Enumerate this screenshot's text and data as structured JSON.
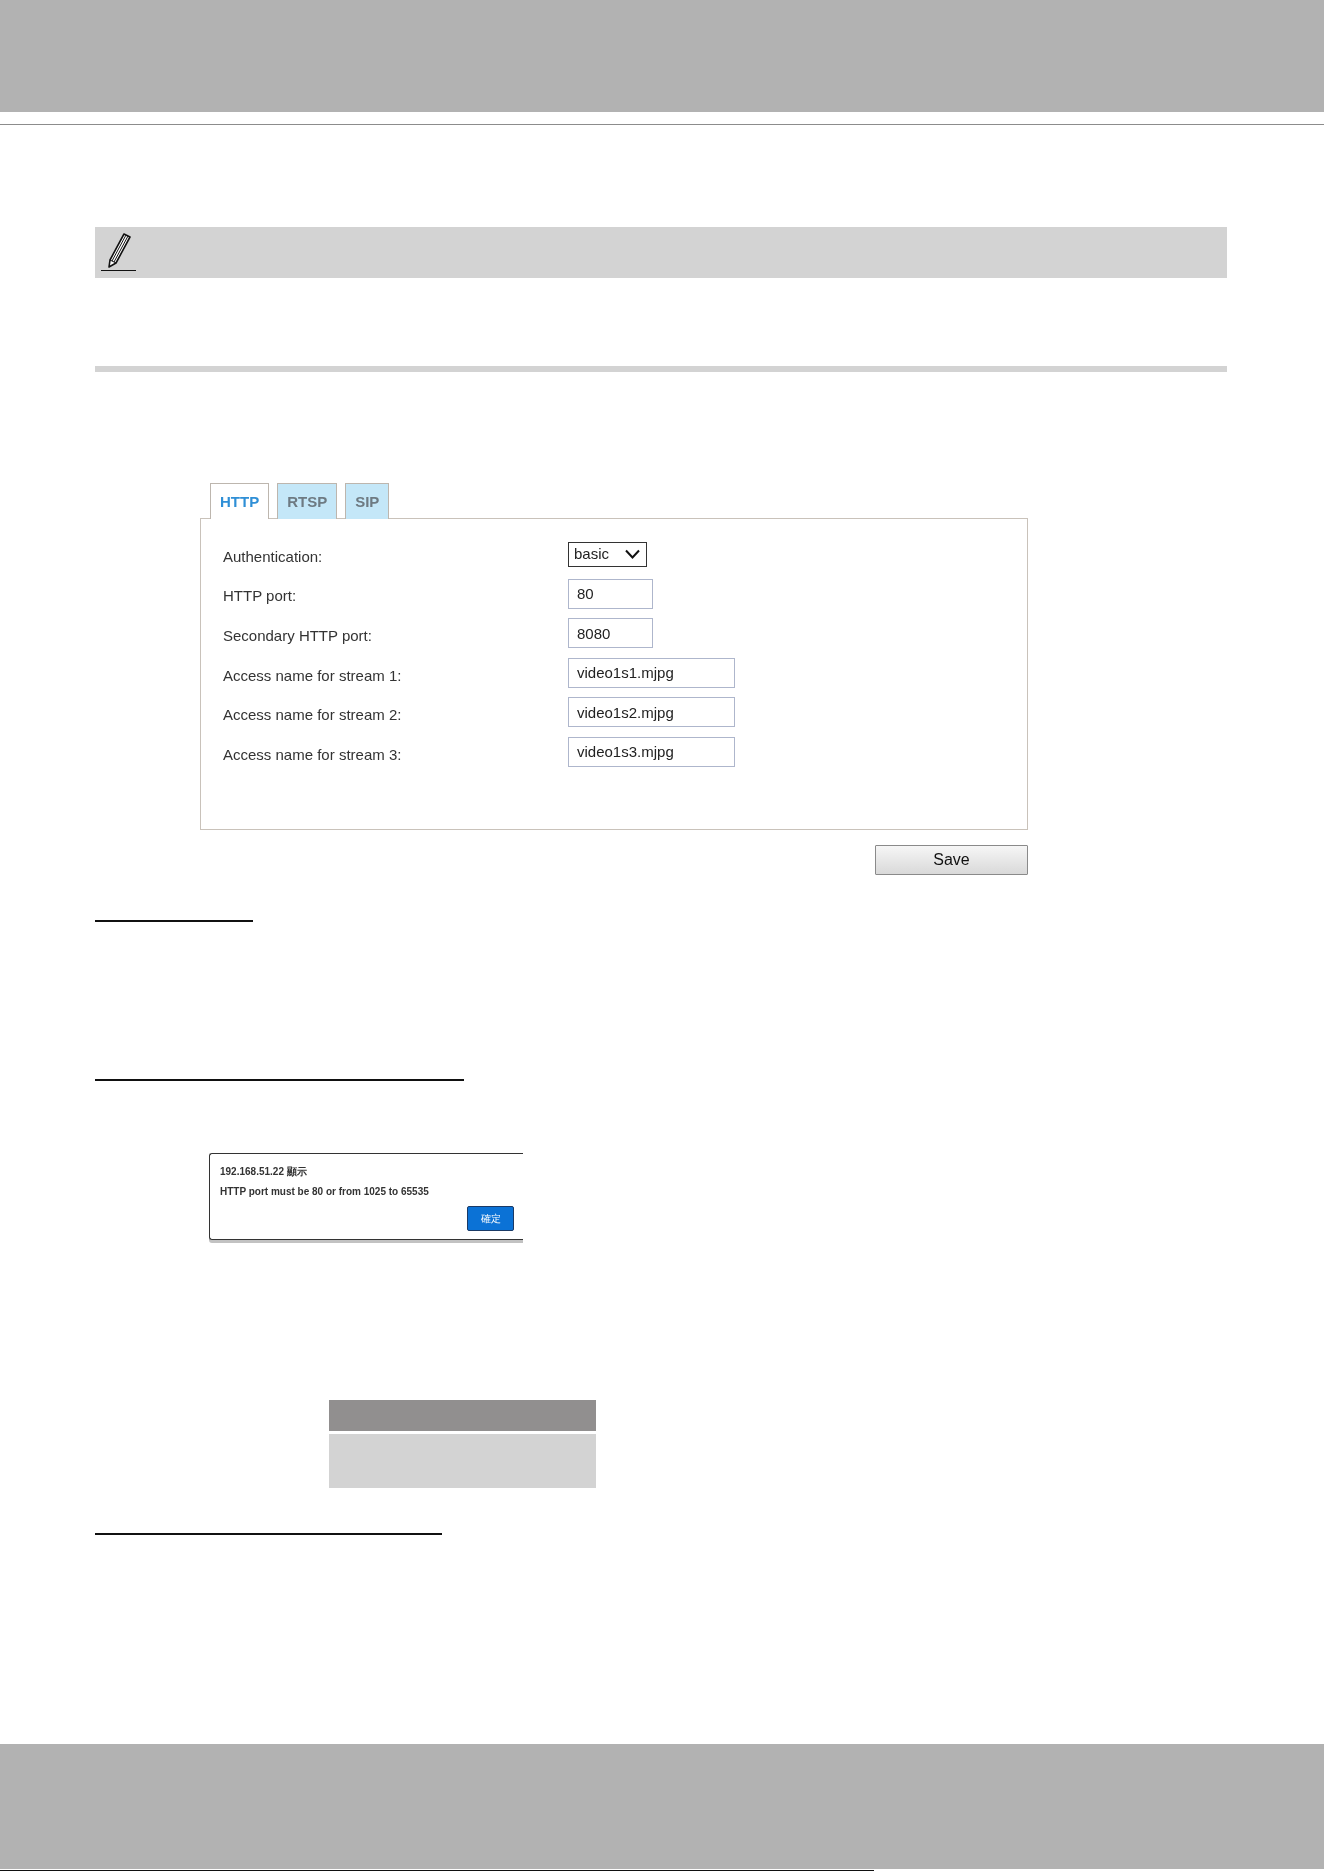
{
  "settings_panel": {
    "tabs": [
      {
        "label": "HTTP",
        "selected": true
      },
      {
        "label": "RTSP",
        "selected": false
      },
      {
        "label": "SIP",
        "selected": false
      }
    ],
    "fields": [
      {
        "kind": "select",
        "label": "Authentication:",
        "value": "basic"
      },
      {
        "kind": "number",
        "label": "HTTP port:",
        "value": "80"
      },
      {
        "kind": "number",
        "label": "Secondary HTTP port:",
        "value": "8080"
      },
      {
        "kind": "text",
        "label": "Access name for stream 1:",
        "value": "video1s1.mjpg"
      },
      {
        "kind": "text",
        "label": "Access name for stream 2:",
        "value": "video1s2.mjpg"
      },
      {
        "kind": "text",
        "label": "Access name for stream 3:",
        "value": "video1s3.mjpg"
      }
    ],
    "save_button": "Save"
  },
  "alert_dialog": {
    "title": "192.168.51.22 顯示",
    "message": "HTTP port must be 80 or from 1025 to 65535",
    "button": "確定"
  }
}
